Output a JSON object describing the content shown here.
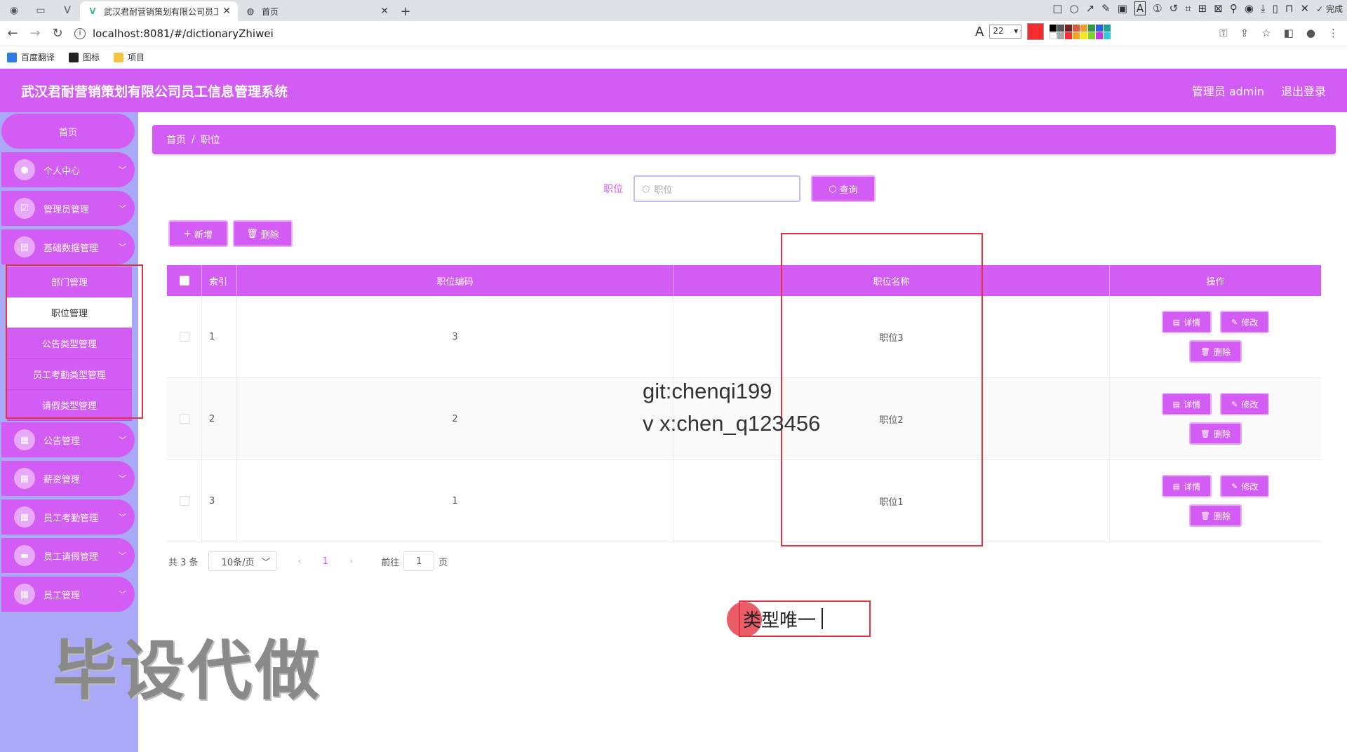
{
  "browser": {
    "tabs": [
      {
        "title": "武汉君耐营销策划有限公司员工"
      },
      {
        "title": "首页"
      }
    ],
    "url": "localhost:8081/#/dictionaryZhiwei",
    "font_size": "22",
    "done_label": "完成",
    "bookmarks": [
      "百度翻译",
      "图标",
      "项目"
    ]
  },
  "header": {
    "title": "武汉君耐营销策划有限公司员工信息管理系统",
    "user": "管理员 admin",
    "logout": "退出登录"
  },
  "sidebar": {
    "home": "首页",
    "menus": [
      {
        "label": "个人中心"
      },
      {
        "label": "管理员管理"
      },
      {
        "label": "基础数据管理"
      },
      {
        "label": "公告管理"
      },
      {
        "label": "薪资管理"
      },
      {
        "label": "员工考勤管理"
      },
      {
        "label": "员工请假管理"
      },
      {
        "label": "员工管理"
      }
    ],
    "submenu": [
      "部门管理",
      "职位管理",
      "公告类型管理",
      "员工考勤类型管理",
      "请假类型管理"
    ]
  },
  "breadcrumb": {
    "home": "首页",
    "sep": "/",
    "current": "职位"
  },
  "search": {
    "label": "职位",
    "placeholder": "职位",
    "button": "查询"
  },
  "actions": {
    "add": "新增",
    "delete": "删除"
  },
  "table": {
    "headers": [
      "索引",
      "职位编码",
      "职位名称",
      "操作"
    ],
    "rows": [
      {
        "index": "1",
        "code": "3",
        "name": "职位3"
      },
      {
        "index": "2",
        "code": "2",
        "name": "职位2"
      },
      {
        "index": "3",
        "code": "1",
        "name": "职位1"
      }
    ],
    "ops": {
      "detail": "详情",
      "edit": "修改",
      "delete": "删除"
    }
  },
  "pagination": {
    "total": "共 3 条",
    "page_size": "10条/页",
    "current": "1",
    "goto_prefix": "前往",
    "goto_value": "1",
    "goto_suffix": "页"
  },
  "overlay": {
    "line1": "git:chenqi199",
    "line2": "v x:chen_q123456",
    "note": "类型唯一",
    "watermark": "毕设代做"
  },
  "colors": {
    "primary": "#d35cf5",
    "sidebar_bg": "#a9a9f7",
    "annotation": "#e53340"
  }
}
